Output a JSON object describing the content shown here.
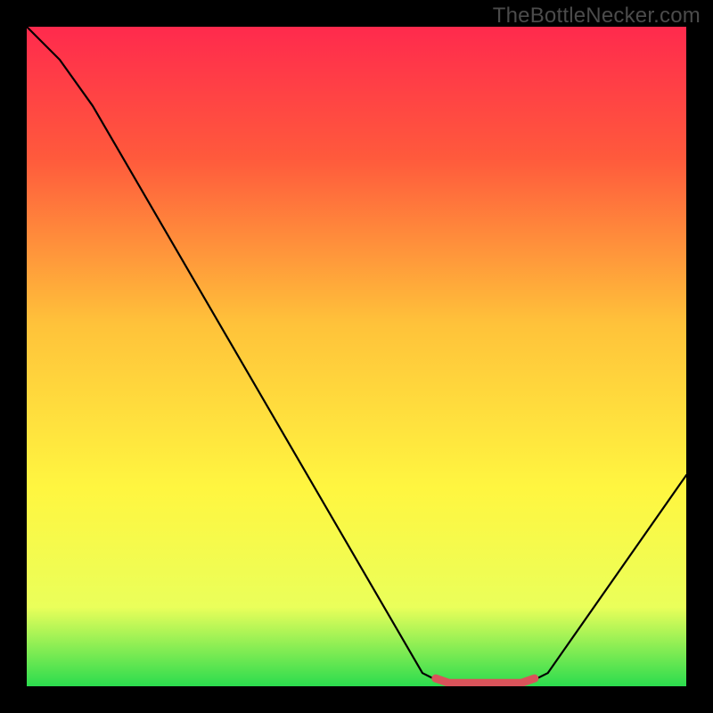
{
  "watermark": "TheBottleNecker.com",
  "chart_data": {
    "type": "line",
    "title": "",
    "xlabel": "",
    "ylabel": "",
    "xlim": [
      0,
      100
    ],
    "ylim": [
      0,
      100
    ],
    "gradient_stops": [
      {
        "offset": 0,
        "color": "#ff2a4d"
      },
      {
        "offset": 20,
        "color": "#ff5a3c"
      },
      {
        "offset": 45,
        "color": "#ffc23a"
      },
      {
        "offset": 70,
        "color": "#fff640"
      },
      {
        "offset": 88,
        "color": "#eaff5a"
      },
      {
        "offset": 100,
        "color": "#2bdc4e"
      }
    ],
    "series": [
      {
        "name": "bottleneck-curve",
        "color": "#000000",
        "width": 2.2,
        "points": [
          {
            "x": 0,
            "y": 100
          },
          {
            "x": 5,
            "y": 95
          },
          {
            "x": 10,
            "y": 88
          },
          {
            "x": 60,
            "y": 2
          },
          {
            "x": 63,
            "y": 0.5
          },
          {
            "x": 76,
            "y": 0.5
          },
          {
            "x": 79,
            "y": 2
          },
          {
            "x": 100,
            "y": 32
          }
        ]
      },
      {
        "name": "optimal-band",
        "color": "#d9535a",
        "width": 9,
        "points": [
          {
            "x": 62,
            "y": 1.2
          },
          {
            "x": 64,
            "y": 0.5
          },
          {
            "x": 75,
            "y": 0.5
          },
          {
            "x": 77,
            "y": 1.2
          }
        ]
      }
    ]
  }
}
